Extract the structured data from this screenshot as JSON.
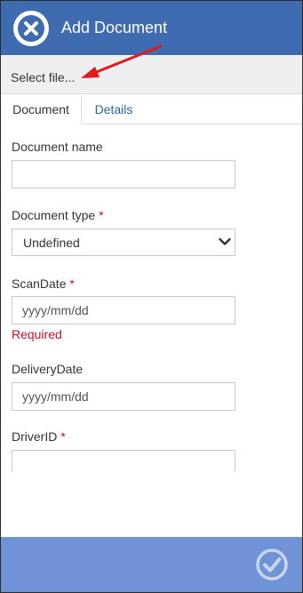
{
  "header": {
    "title": "Add Document",
    "close_icon": "close-icon",
    "bg_color": "#3f6bb0"
  },
  "file_picker": {
    "label": "Select file..."
  },
  "tabs": [
    {
      "label": "Document",
      "active": true
    },
    {
      "label": "Details",
      "active": false
    }
  ],
  "form": {
    "document_name": {
      "label": "Document name",
      "value": ""
    },
    "document_type": {
      "label": "Document type",
      "required_mark": "*",
      "value": "Undefined"
    },
    "scan_date": {
      "label": "ScanDate",
      "required_mark": "*",
      "placeholder": "yyyy/mm/dd",
      "error": "Required"
    },
    "delivery_date": {
      "label": "DeliveryDate",
      "placeholder": "yyyy/mm/dd"
    },
    "driver_id": {
      "label": "DriverID",
      "required_mark": "*",
      "value": ""
    }
  },
  "footer": {
    "confirm_icon": "check-circle-icon",
    "bg_color": "#6f93d6"
  },
  "colors": {
    "required": "#c8102e",
    "link": "#2a6496",
    "annotation_arrow": "#e01b1b"
  }
}
